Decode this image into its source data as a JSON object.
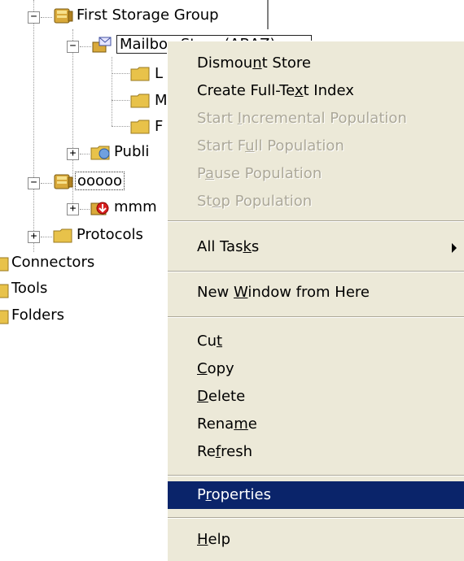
{
  "tree": {
    "first_storage_group": "First Storage Group",
    "mailbox_store": "Mailbox Store (ABAZ)",
    "child_l": "L",
    "child_m": "M",
    "child_f": "F",
    "public": "Publi",
    "ooooo": "ooooo",
    "mmm": "mmm",
    "protocols": "Protocols",
    "connectors": "Connectors",
    "tools": "Tools",
    "folders": "Folders"
  },
  "menu": {
    "dismount_store": {
      "pre": "Dismou",
      "key": "n",
      "post": "t Store"
    },
    "create_index": {
      "pre": "Create Full-Te",
      "key": "x",
      "post": "t Index"
    },
    "start_incremental": {
      "pre": "Start ",
      "key": "I",
      "post": "ncremental Population"
    },
    "start_full": {
      "pre": "Start F",
      "key": "u",
      "post": "ll Population"
    },
    "pause": {
      "pre": "P",
      "key": "a",
      "post": "use Population"
    },
    "stop": {
      "pre": "St",
      "key": "o",
      "post": "p Population"
    },
    "all_tasks": {
      "pre": "All Tas",
      "key": "k",
      "post": "s"
    },
    "new_window": {
      "pre": "New ",
      "key": "W",
      "post": "indow from Here"
    },
    "cut": {
      "pre": "Cu",
      "key": "t",
      "post": ""
    },
    "copy": {
      "pre": "",
      "key": "C",
      "post": "opy"
    },
    "delete": {
      "pre": "",
      "key": "D",
      "post": "elete"
    },
    "rename": {
      "pre": "Rena",
      "key": "m",
      "post": "e"
    },
    "refresh": {
      "pre": "Re",
      "key": "f",
      "post": "resh"
    },
    "properties": {
      "pre": "P",
      "key": "r",
      "post": "operties"
    },
    "help": {
      "pre": "",
      "key": "H",
      "post": "elp"
    }
  },
  "colors": {
    "menu_bg": "#ece9d8",
    "highlight": "#0a246a",
    "disabled_text": "#aca899",
    "folder": "#e8c24a"
  }
}
